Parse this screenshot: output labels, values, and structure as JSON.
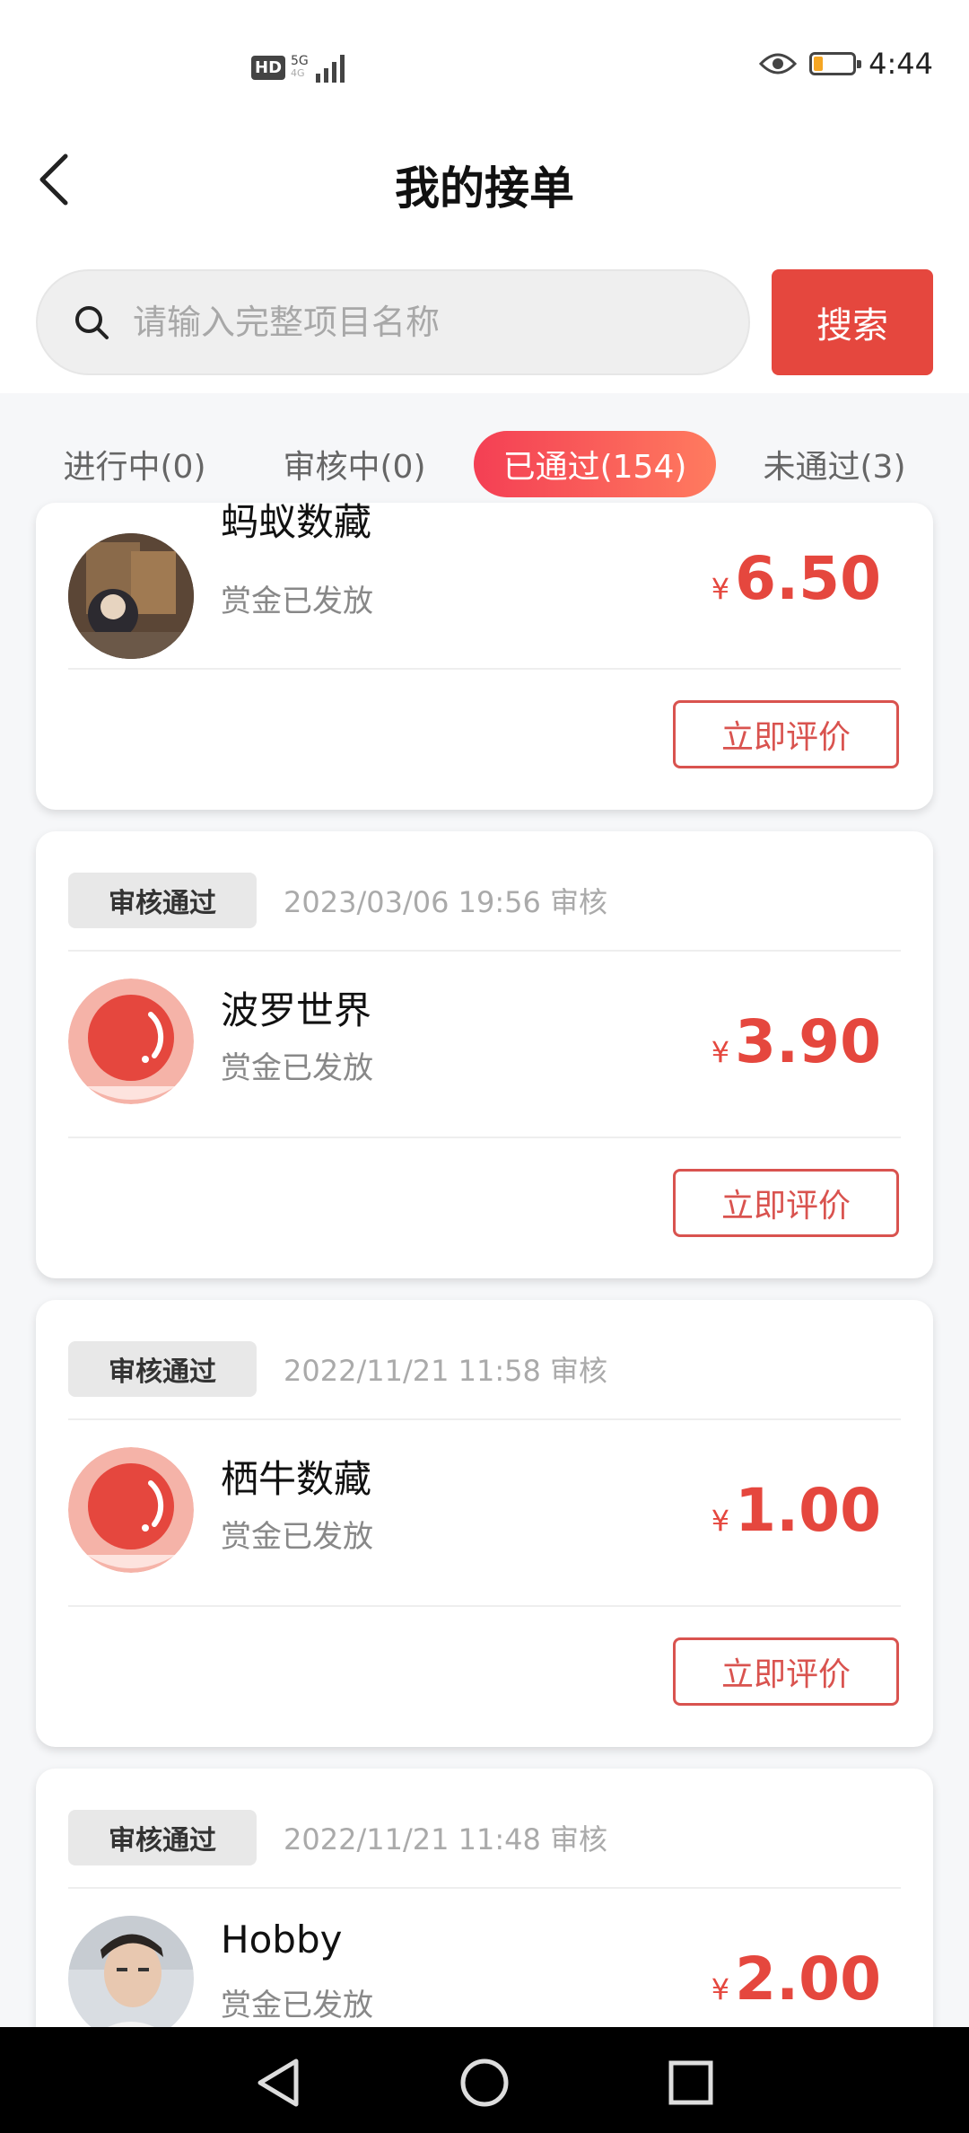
{
  "status_bar": {
    "hd": "HD",
    "network_top": "5G",
    "network_bottom": "4G",
    "time": "4:44"
  },
  "header": {
    "title": "我的接单"
  },
  "search": {
    "placeholder": "请输入完整项目名称",
    "button_label": "搜索"
  },
  "tabs": [
    {
      "label": "进行中(0)",
      "active": false
    },
    {
      "label": "审核中(0)",
      "active": false
    },
    {
      "label": "已通过(154)",
      "active": true
    },
    {
      "label": "未通过(3)",
      "active": false
    }
  ],
  "orders": [
    {
      "project": "蚂蚁数藏",
      "status": "赏金已发放",
      "currency": "¥",
      "amount": "6.50",
      "action_label": "立即评价"
    },
    {
      "badge": "审核通过",
      "review_time": "2023/03/06 19:56 审核",
      "project": "波罗世界",
      "status": "赏金已发放",
      "currency": "¥",
      "amount": "3.90",
      "action_label": "立即评价"
    },
    {
      "badge": "审核通过",
      "review_time": "2022/11/21 11:58 审核",
      "project": "栖牛数藏",
      "status": "赏金已发放",
      "currency": "¥",
      "amount": "1.00",
      "action_label": "立即评价"
    },
    {
      "badge": "审核通过",
      "review_time": "2022/11/21 11:48 审核",
      "project": "Hobby",
      "status": "赏金已发放",
      "currency": "¥",
      "amount": "2.00"
    }
  ],
  "colors": {
    "accent": "#e5473e",
    "tab_active_start": "#f43f54",
    "tab_active_end": "#ff7b5f"
  }
}
